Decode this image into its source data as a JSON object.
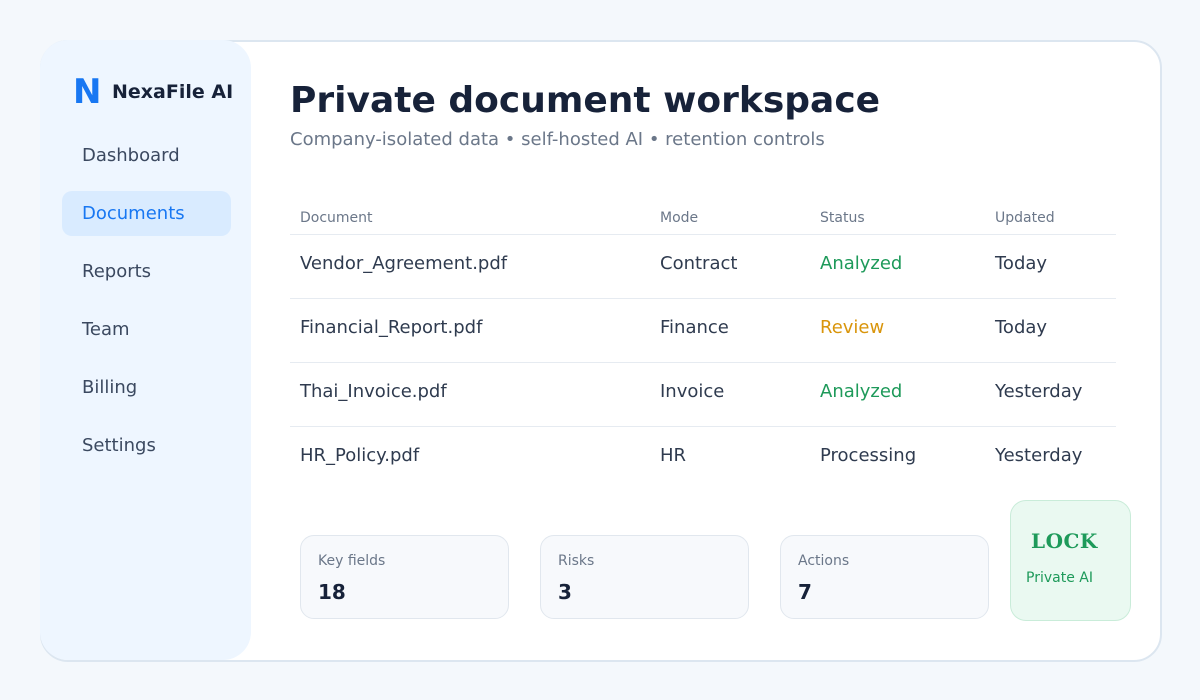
{
  "brand": {
    "logo_letter": "N",
    "name": "NexaFile AI"
  },
  "sidebar": {
    "items": [
      {
        "label": "Dashboard",
        "active": false
      },
      {
        "label": "Documents",
        "active": true
      },
      {
        "label": "Reports",
        "active": false
      },
      {
        "label": "Team",
        "active": false
      },
      {
        "label": "Billing",
        "active": false
      },
      {
        "label": "Settings",
        "active": false
      }
    ]
  },
  "main": {
    "title": "Private document workspace",
    "subtitle": "Company-isolated data • self-hosted AI • retention controls"
  },
  "table": {
    "columns": [
      "Document",
      "Mode",
      "Status",
      "Updated"
    ],
    "rows": [
      {
        "document": "Vendor_Agreement.pdf",
        "mode": "Contract",
        "status": "Analyzed",
        "status_color": "#1e9a5a",
        "updated": "Today"
      },
      {
        "document": "Financial_Report.pdf",
        "mode": "Finance",
        "status": "Review",
        "status_color": "#d9950b",
        "updated": "Today"
      },
      {
        "document": "Thai_Invoice.pdf",
        "mode": "Invoice",
        "status": "Analyzed",
        "status_color": "#1e9a5a",
        "updated": "Yesterday"
      },
      {
        "document": "HR_Policy.pdf",
        "mode": "HR",
        "status": "Processing",
        "status_color": "#2f3b4f",
        "updated": "Yesterday"
      }
    ]
  },
  "stats": [
    {
      "label": "Key fields",
      "value": "18"
    },
    {
      "label": "Risks",
      "value": "3"
    },
    {
      "label": "Actions",
      "value": "7"
    }
  ],
  "lock": {
    "title": "LOCK",
    "subtitle": "Private AI"
  },
  "colors": {
    "accent": "#1877f2",
    "success": "#1e9a5a",
    "warning": "#d9950b"
  }
}
